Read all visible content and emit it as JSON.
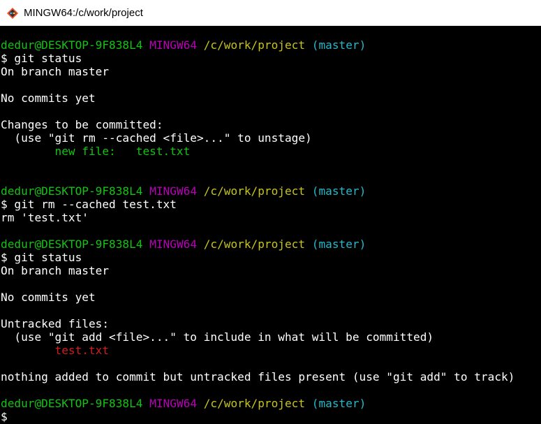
{
  "window": {
    "title": "MINGW64:/c/work/project",
    "icon": "git-bash-icon"
  },
  "colors": {
    "prompt_user": "#13c313",
    "prompt_system": "#b900b9",
    "prompt_path": "#c7c41c",
    "prompt_branch": "#23b9cb",
    "staged_file": "#13c313",
    "untracked_file": "#d01d1d",
    "text": "#ffffff",
    "background": "#000000"
  },
  "prompt": {
    "user_host": "dedur@DESKTOP-9F838L4",
    "system": "MINGW64",
    "path": "/c/work/project",
    "branch": "(master)"
  },
  "output": {
    "cmd1": "$ git status",
    "on_branch_1": "On branch master",
    "no_commits_1": "No commits yet",
    "changes_header": "Changes to be committed:",
    "unstage_hint": "  (use \"git rm --cached <file>...\" to unstage)",
    "new_file": "        new file:   test.txt",
    "cmd2": "$ git rm --cached test.txt",
    "rm_output": "rm 'test.txt'",
    "cmd3": "$ git status",
    "on_branch_2": "On branch master",
    "no_commits_2": "No commits yet",
    "untracked_header": "Untracked files:",
    "add_hint": "  (use \"git add <file>...\" to include in what will be committed)",
    "untracked_file": "        test.txt",
    "nothing_added": "nothing added to commit but untracked files present (use \"git add\" to track)",
    "final_prompt": "$"
  }
}
